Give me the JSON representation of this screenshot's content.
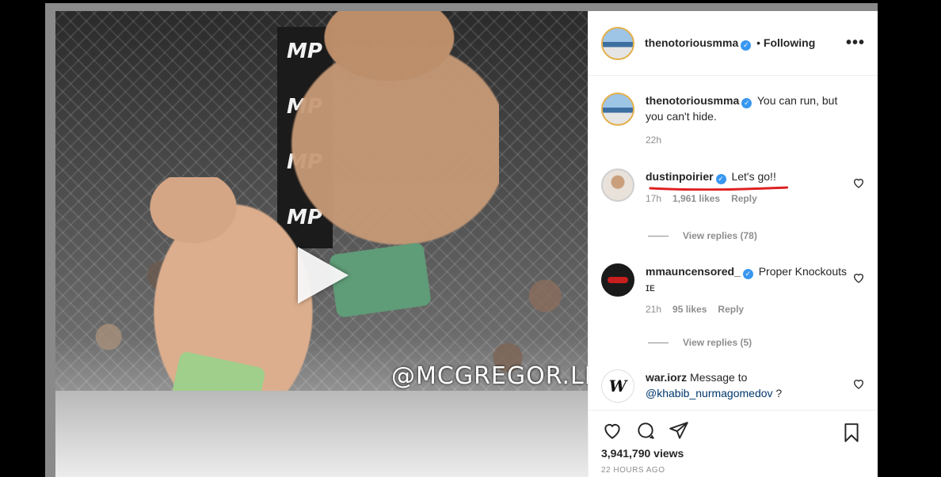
{
  "post": {
    "author": "thenotoriousmma",
    "follow_status": "Following",
    "more_label": "•••",
    "media": {
      "banner_text": "MP",
      "watermark": "@MCGREGOR.LION"
    }
  },
  "caption": {
    "username": "thenotoriousmma",
    "text": "You can run, but you can't hide.",
    "time": "22h"
  },
  "comments": [
    {
      "username": "dustinpoirier",
      "text": "Let's go!!",
      "time": "17h",
      "likes": "1,961 likes",
      "reply_label": "Reply",
      "view_replies": "View replies (78)"
    },
    {
      "username": "mmauncensored_",
      "text": "Proper Knockouts ɪᴇ",
      "time": "21h",
      "likes": "95 likes",
      "reply_label": "Reply",
      "view_replies": "View replies (5)"
    },
    {
      "username": "war.iorz",
      "text": "Message to",
      "mention": "@khabib_nurmagomedov",
      "suffix": " ?"
    }
  ],
  "footer": {
    "views": "3,941,790 views",
    "ago": "22 HOURS AGO"
  },
  "colors": {
    "verified": "#3897f0",
    "highlight_underline": "#e02020"
  }
}
